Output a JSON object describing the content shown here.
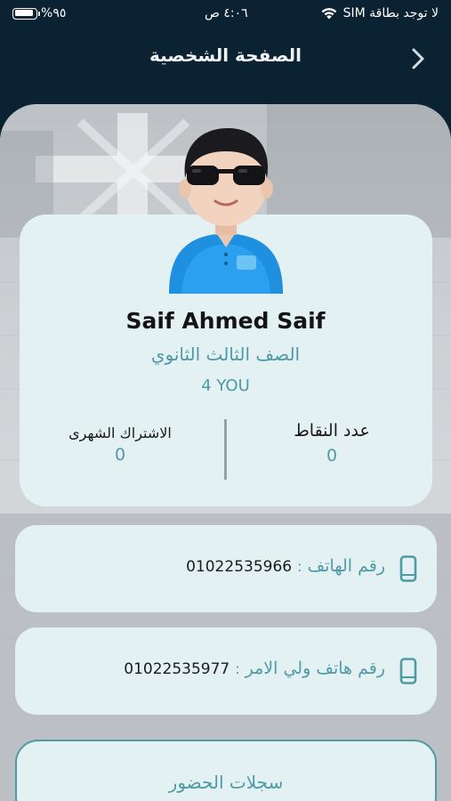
{
  "status_bar": {
    "battery": "%٩٥",
    "battery_level": 0.95,
    "time": "٤:٠٦ ص",
    "carrier": "لا توجد بطاقة SIM"
  },
  "header": {
    "title": "الصفحة الشخصية",
    "back_icon": "chevron-right-icon"
  },
  "profile": {
    "name": "Saif Ahmed Saif",
    "grade": "الصف الثالث الثانوي",
    "group": "4 YOU",
    "avatar_icon": "avatar-with-sunglasses"
  },
  "stats": {
    "points_label": "عدد النقاط",
    "points_value": "0",
    "subscription_label": "الاشتراك الشهرى",
    "subscription_value": "0"
  },
  "contacts": {
    "phone_label": "رقم الهاتف",
    "phone_colon": ":",
    "phone_value": "01022535966",
    "parent_phone_label": "رقم هاتف ولي الامر",
    "parent_phone_colon": ":",
    "parent_phone_value": "01022535977",
    "icon": "mobile-phone-icon"
  },
  "actions": {
    "attendance_label": "سجلات الحضور"
  },
  "colors": {
    "header_bg": "#0b2233",
    "card_bg": "#e4f1f3",
    "accent": "#4e9aa6"
  }
}
